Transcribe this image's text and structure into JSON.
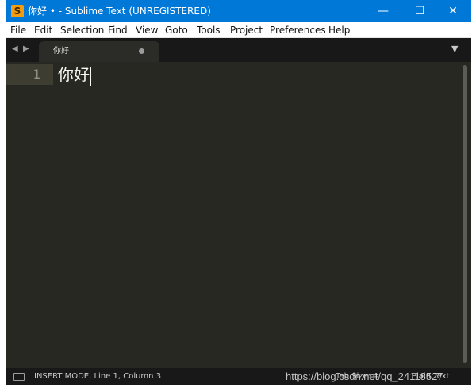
{
  "window": {
    "title": "你好 • - Sublime Text (UNREGISTERED)",
    "app_icon_glyph": "S",
    "minimize_glyph": "—",
    "maximize_glyph": "☐",
    "close_glyph": "✕"
  },
  "menu": {
    "items": [
      "File",
      "Edit",
      "Selection",
      "Find",
      "View",
      "Goto",
      "Tools",
      "Project",
      "Preferences",
      "Help"
    ]
  },
  "tabbar": {
    "nav_back_glyph": "◀",
    "nav_forward_glyph": "▶",
    "dropdown_glyph": "▼",
    "tabs": [
      {
        "label": "你好",
        "modified": true
      }
    ]
  },
  "editor": {
    "lines": [
      {
        "number": "1",
        "text": "你好"
      }
    ],
    "theme": {
      "background": "#272822",
      "gutter_highlight": "#3e3d32",
      "text": "#f8f8f2",
      "line_number": "#8f908a"
    }
  },
  "statusbar": {
    "mode_text": "INSERT MODE, Line 1, Column 3",
    "tab_size_text": "Tab Size: 4",
    "syntax_text": "Plain Text"
  },
  "watermark": {
    "text": "https://blog.csdn.net/qq_24118527"
  },
  "colors": {
    "titlebar": "#0078d7",
    "chrome_dark": "#171817",
    "accent_icon": "#f39c12"
  }
}
